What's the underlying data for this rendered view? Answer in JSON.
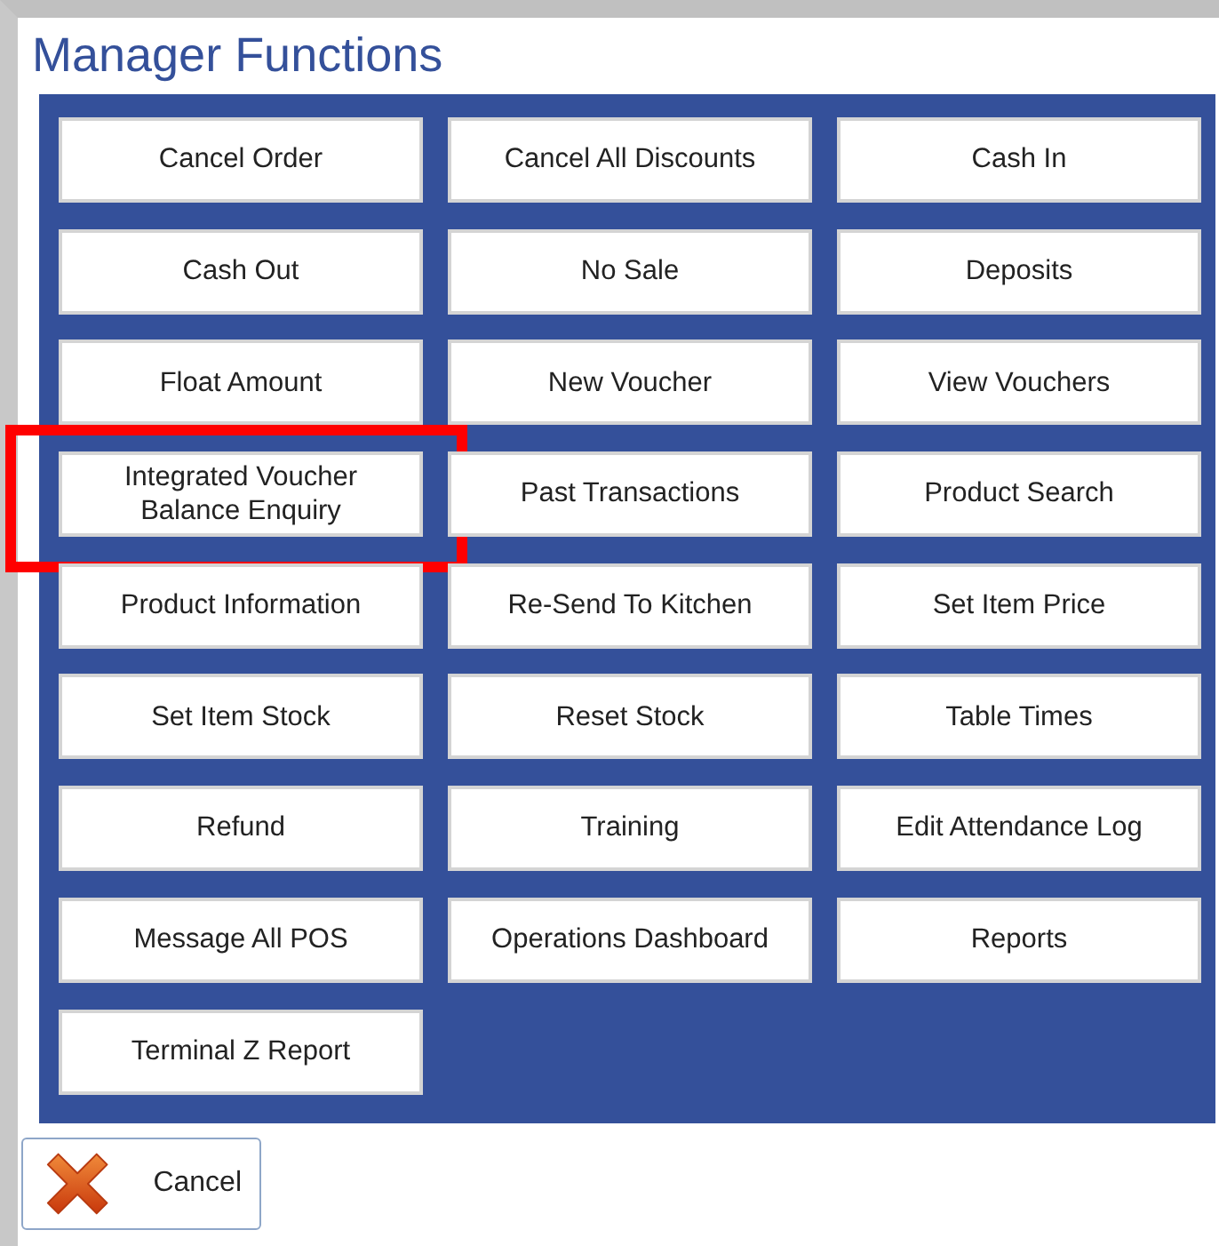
{
  "window": {
    "title": "Manager Functions"
  },
  "functions": [
    {
      "label": "Cancel Order",
      "highlighted": false
    },
    {
      "label": "Cancel All Discounts",
      "highlighted": false
    },
    {
      "label": "Cash In",
      "highlighted": false
    },
    {
      "label": "Cash Out",
      "highlighted": false
    },
    {
      "label": "No Sale",
      "highlighted": false
    },
    {
      "label": "Deposits",
      "highlighted": false
    },
    {
      "label": "Float Amount",
      "highlighted": false
    },
    {
      "label": "New Voucher",
      "highlighted": false
    },
    {
      "label": "View Vouchers",
      "highlighted": false
    },
    {
      "label": "Integrated Voucher\nBalance Enquiry",
      "highlighted": true
    },
    {
      "label": "Past Transactions",
      "highlighted": false
    },
    {
      "label": "Product Search",
      "highlighted": false
    },
    {
      "label": "Product Information",
      "highlighted": false
    },
    {
      "label": "Re-Send To Kitchen",
      "highlighted": false
    },
    {
      "label": "Set Item Price",
      "highlighted": false
    },
    {
      "label": "Set Item Stock",
      "highlighted": false
    },
    {
      "label": "Reset Stock",
      "highlighted": false
    },
    {
      "label": "Table Times",
      "highlighted": false
    },
    {
      "label": "Refund",
      "highlighted": false
    },
    {
      "label": "Training",
      "highlighted": false
    },
    {
      "label": "Edit Attendance Log",
      "highlighted": false
    },
    {
      "label": "Message All POS",
      "highlighted": false
    },
    {
      "label": "Operations Dashboard",
      "highlighted": false
    },
    {
      "label": "Reports",
      "highlighted": false
    },
    {
      "label": "Terminal Z Report",
      "highlighted": false
    }
  ],
  "cancel_button": {
    "label": "Cancel"
  }
}
